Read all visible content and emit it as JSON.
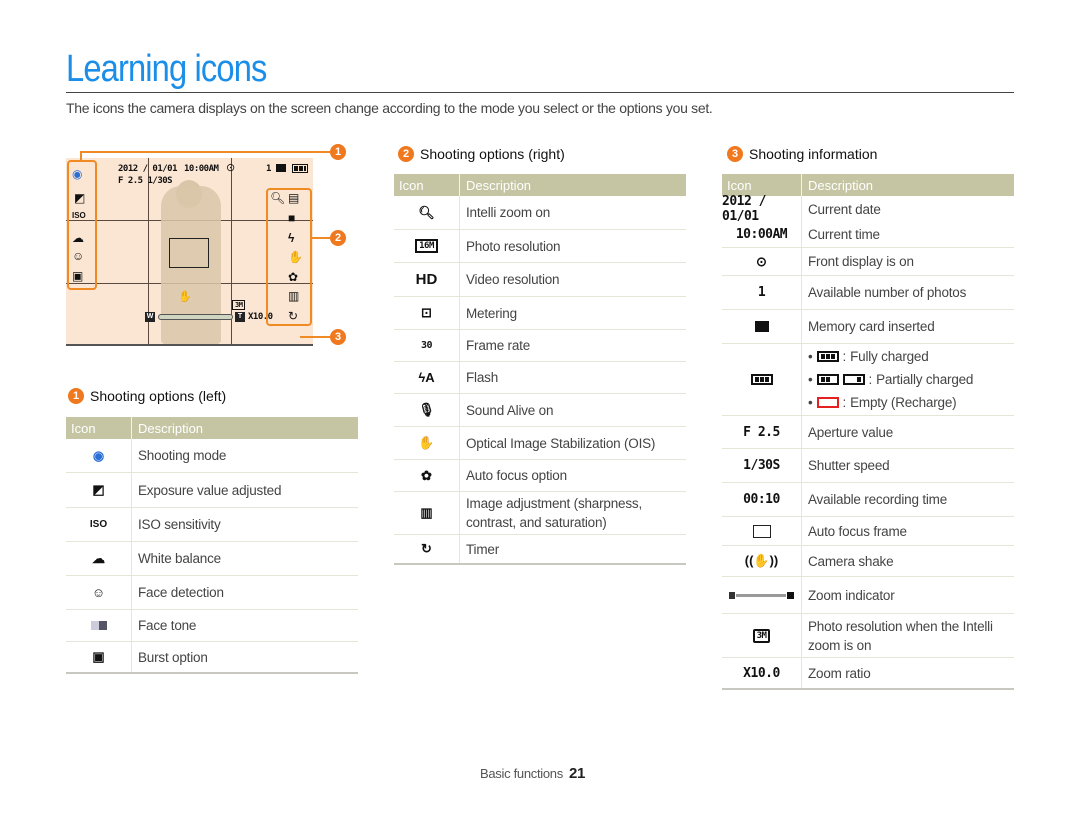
{
  "page": {
    "title": "Learning icons",
    "intro": "The icons the camera displays on the screen change according to the mode you select or the options you set.",
    "footer_label": "Basic functions",
    "page_number": "21",
    "accent_color": "#1a8ee8",
    "callout_color": "#f0781e"
  },
  "camera_screen": {
    "date": "2012 / 01/01",
    "time": "10:00AM",
    "aperture_shutter": "F 2.5  1/30S",
    "photo_count": "1",
    "zoom_ratio": "X10.0",
    "zoom_wide": "W",
    "zoom_tele": "T",
    "intelli_res": "3M"
  },
  "callouts": [
    "1",
    "2",
    "3"
  ],
  "sections": {
    "left": {
      "number": "1",
      "title": "Shooting options (left)",
      "header_icon": "Icon",
      "header_desc": "Description",
      "rows": [
        {
          "icon": "shooting-mode-icon",
          "desc": "Shooting mode"
        },
        {
          "icon": "exposure-icon",
          "desc": "Exposure value adjusted"
        },
        {
          "icon": "iso-icon",
          "desc": "ISO sensitivity"
        },
        {
          "icon": "white-balance-icon",
          "desc": "White balance"
        },
        {
          "icon": "face-detection-icon",
          "desc": "Face detection"
        },
        {
          "icon": "face-tone-icon",
          "desc": "Face tone"
        },
        {
          "icon": "burst-icon",
          "desc": "Burst option"
        }
      ]
    },
    "right": {
      "number": "2",
      "title": "Shooting options (right)",
      "header_icon": "Icon",
      "header_desc": "Description",
      "rows": [
        {
          "icon": "intelli-zoom-icon",
          "desc": "Intelli zoom on"
        },
        {
          "icon": "photo-resolution-icon",
          "desc": "Photo resolution",
          "glyph": "16M"
        },
        {
          "icon": "video-resolution-icon",
          "desc": "Video resolution",
          "glyph": "HD"
        },
        {
          "icon": "metering-icon",
          "desc": "Metering"
        },
        {
          "icon": "frame-rate-icon",
          "desc": "Frame rate",
          "glyph": "30"
        },
        {
          "icon": "flash-icon",
          "desc": "Flash",
          "glyph": "ϟA"
        },
        {
          "icon": "sound-alive-icon",
          "desc": "Sound Alive on"
        },
        {
          "icon": "ois-icon",
          "desc": "Optical Image Stabilization (OIS)"
        },
        {
          "icon": "auto-focus-icon",
          "desc": "Auto focus option"
        },
        {
          "icon": "image-adjust-icon",
          "desc": "Image adjustment (sharpness, contrast, and saturation)"
        },
        {
          "icon": "timer-icon",
          "desc": "Timer"
        }
      ]
    },
    "info": {
      "number": "3",
      "title": "Shooting information",
      "header_icon": "Icon",
      "header_desc": "Description",
      "rows": [
        {
          "icon": "date-icon",
          "glyph": "2012 / 01/01",
          "desc": "Current date"
        },
        {
          "icon": "time-icon",
          "glyph": "10:00AM",
          "desc": "Current time"
        },
        {
          "icon": "front-display-icon",
          "desc": "Front display is on"
        },
        {
          "icon": "photo-count-icon",
          "glyph": "1",
          "desc": "Available number of photos"
        },
        {
          "icon": "memory-card-icon",
          "desc": "Memory card inserted"
        },
        {
          "icon": "battery-icon",
          "battery": [
            "Fully charged",
            "Partially charged",
            "Empty (Recharge)"
          ]
        },
        {
          "icon": "aperture-icon",
          "glyph": "F 2.5",
          "desc": "Aperture value"
        },
        {
          "icon": "shutter-icon",
          "glyph": "1/30S",
          "desc": "Shutter speed"
        },
        {
          "icon": "recording-time-icon",
          "glyph": "00:10",
          "desc": "Available recording time"
        },
        {
          "icon": "af-frame-icon",
          "desc": "Auto focus frame"
        },
        {
          "icon": "camera-shake-icon",
          "desc": "Camera shake"
        },
        {
          "icon": "zoom-indicator-icon",
          "desc": "Zoom indicator"
        },
        {
          "icon": "intelli-resolution-icon",
          "glyph": "3M",
          "desc": "Photo resolution when the Intelli zoom is on"
        },
        {
          "icon": "zoom-ratio-icon",
          "glyph": "X10.0",
          "desc": "Zoom ratio"
        }
      ]
    }
  }
}
